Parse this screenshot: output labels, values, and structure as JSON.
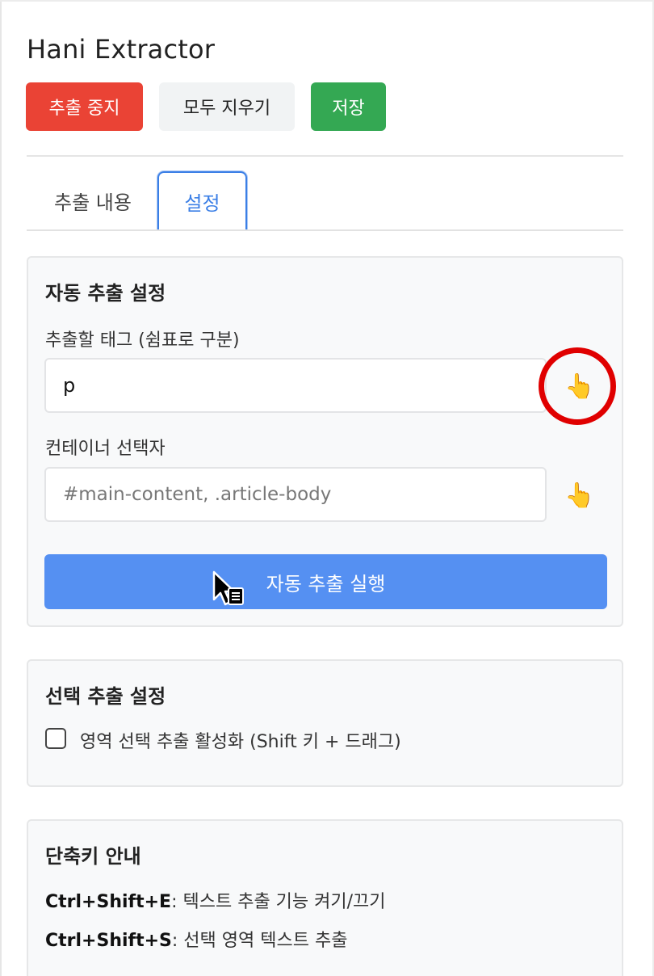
{
  "app": {
    "title": "Hani Extractor"
  },
  "toolbar": {
    "stop_label": "추출 중지",
    "clear_label": "모두 지우기",
    "save_label": "저장"
  },
  "tabs": [
    {
      "label": "추출 내용",
      "active": false
    },
    {
      "label": "설정",
      "active": true
    }
  ],
  "auto_extract": {
    "title": "자동 추출 설정",
    "tags_label": "추출할 태그 (쉼표로 구분)",
    "tags_value": "p",
    "container_label": "컨테이너 선택자",
    "container_placeholder": "#main-content, .article-body",
    "picker_icon": "pointing-hand-emoji",
    "run_label": "자동 추출 실행"
  },
  "select_extract": {
    "title": "선택 추출 설정",
    "checkbox_label": "영역 선택 추출 활성화 (Shift 키 + 드래그)",
    "checkbox_checked": false
  },
  "shortcuts": {
    "title": "단축키 안내",
    "items": [
      {
        "key": "Ctrl+Shift+E",
        "desc": ": 텍스트 추출 기능 켜기/끄기"
      },
      {
        "key": "Ctrl+Shift+S",
        "desc": ": 선택 영역 텍스트 추출"
      }
    ]
  },
  "colors": {
    "stop": "#ea4335",
    "save": "#34a853",
    "accent": "#3b7fe6",
    "run": "#5590f2",
    "highlight": "#e00000"
  }
}
